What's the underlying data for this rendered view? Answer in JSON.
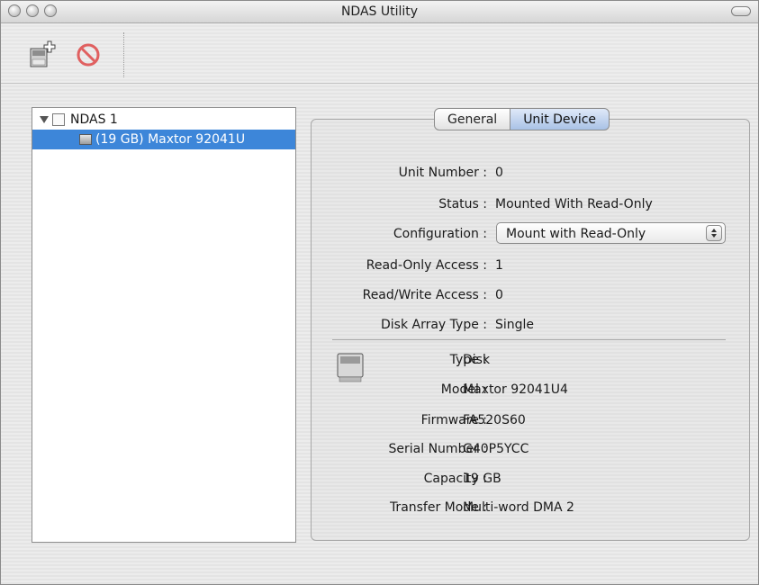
{
  "window": {
    "title": "NDAS Utility"
  },
  "toolbar": {
    "add_icon": "add-device-icon",
    "remove_icon": "remove-device-icon"
  },
  "tree": {
    "root_label": "NDAS 1",
    "child_label": "(19 GB) Maxtor 92041U"
  },
  "tabs": [
    {
      "label": "General"
    },
    {
      "label": "Unit Device"
    }
  ],
  "unit": {
    "fields": [
      {
        "label": "Unit Number :",
        "value": "0"
      },
      {
        "label": "Status :",
        "value": "Mounted With Read-Only"
      },
      {
        "label": "Configuration :",
        "value": ""
      },
      {
        "label": "Read-Only Access :",
        "value": "1"
      },
      {
        "label": "Read/Write Access :",
        "value": "0"
      },
      {
        "label": "Disk Array Type :",
        "value": "Single"
      }
    ],
    "configuration_selected": "Mount with Read-Only"
  },
  "disk": {
    "fields": [
      {
        "label": "Type :",
        "value": "Disk"
      },
      {
        "label": "Model :",
        "value": "Maxtor 92041U4"
      },
      {
        "label": "Firmware :",
        "value": "FA520S60"
      },
      {
        "label": "Serial Number :",
        "value": "G40P5YCC"
      },
      {
        "label": "Capacity :",
        "value": "19 GB"
      },
      {
        "label": "Transfer Mode :",
        "value": "Multi-word DMA 2"
      }
    ]
  },
  "colors": {
    "selection": "#3d86d9",
    "tab_active": "#a9c2e6",
    "remove_icon": "#e06060"
  }
}
